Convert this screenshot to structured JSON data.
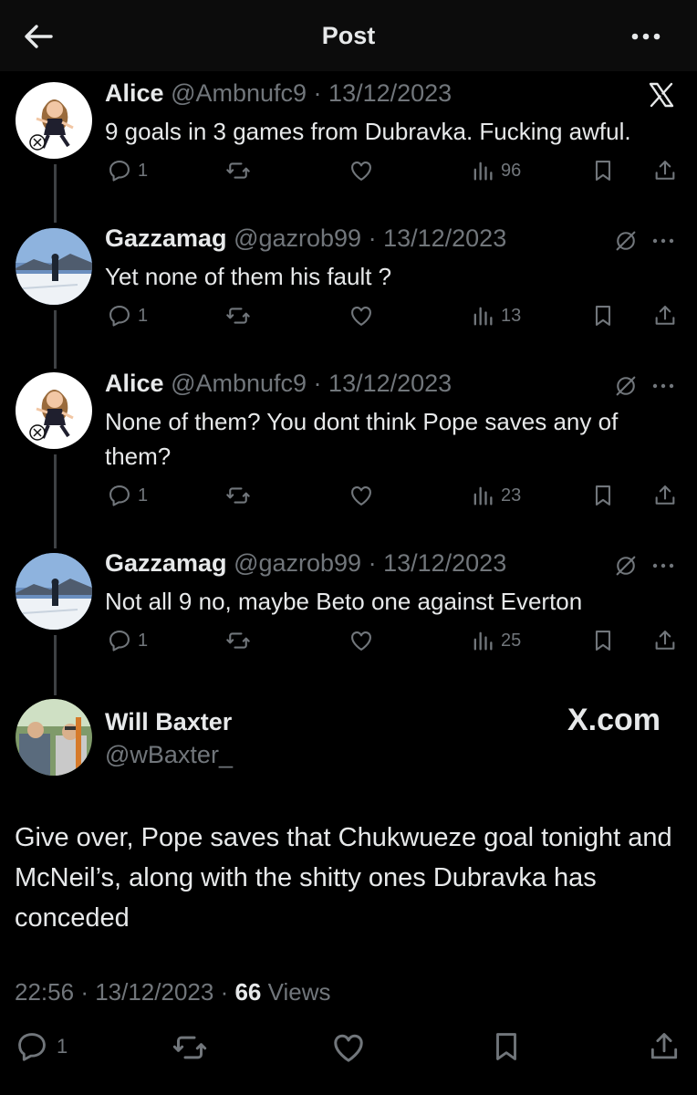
{
  "header": {
    "title": "Post",
    "back_icon": "arrow-left-icon",
    "more_icon": "more-horizontal-icon"
  },
  "thread": [
    {
      "name": "Alice",
      "handle": "@Ambnufc9",
      "date": "13/12/2023",
      "text": "9 goals in 3 games from Dubravka. Fucking awful.",
      "corner": "x-logo-icon",
      "replies": "1",
      "views": "96",
      "avatar": "cartoon-avatar"
    },
    {
      "name": "Gazzamag",
      "handle": "@gazrob99",
      "date": "13/12/2023",
      "text": "Yet none of them his fault ?",
      "corner": "more",
      "replies": "1",
      "views": "13",
      "avatar": "ski-photo-avatar"
    },
    {
      "name": "Alice",
      "handle": "@Ambnufc9",
      "date": "13/12/2023",
      "text": "None of them? You dont think Pope saves any of them?",
      "corner": "more",
      "replies": "1",
      "views": "23",
      "avatar": "cartoon-avatar"
    },
    {
      "name": "Gazzamag",
      "handle": "@gazrob99",
      "date": "13/12/2023",
      "text": "Not all 9 no, maybe Beto one against Everton",
      "corner": "more",
      "replies": "1",
      "views": "25",
      "avatar": "ski-photo-avatar"
    }
  ],
  "quoted_author": {
    "name": "Will Baxter",
    "handle": "@wBaxter_",
    "brand": "X.com"
  },
  "main_post": {
    "text": "Give over, Pope saves that Chukwueze goal tonight and McNeil’s, along with the shitty ones Dubravka has conceded",
    "time": "22:56",
    "date": "13/12/2023",
    "views_count": "66",
    "views_label": "Views",
    "replies": "1"
  },
  "colors": {
    "background": "#000000",
    "text": "#e7e9ea",
    "muted": "#71767b",
    "line": "#3e4144"
  }
}
